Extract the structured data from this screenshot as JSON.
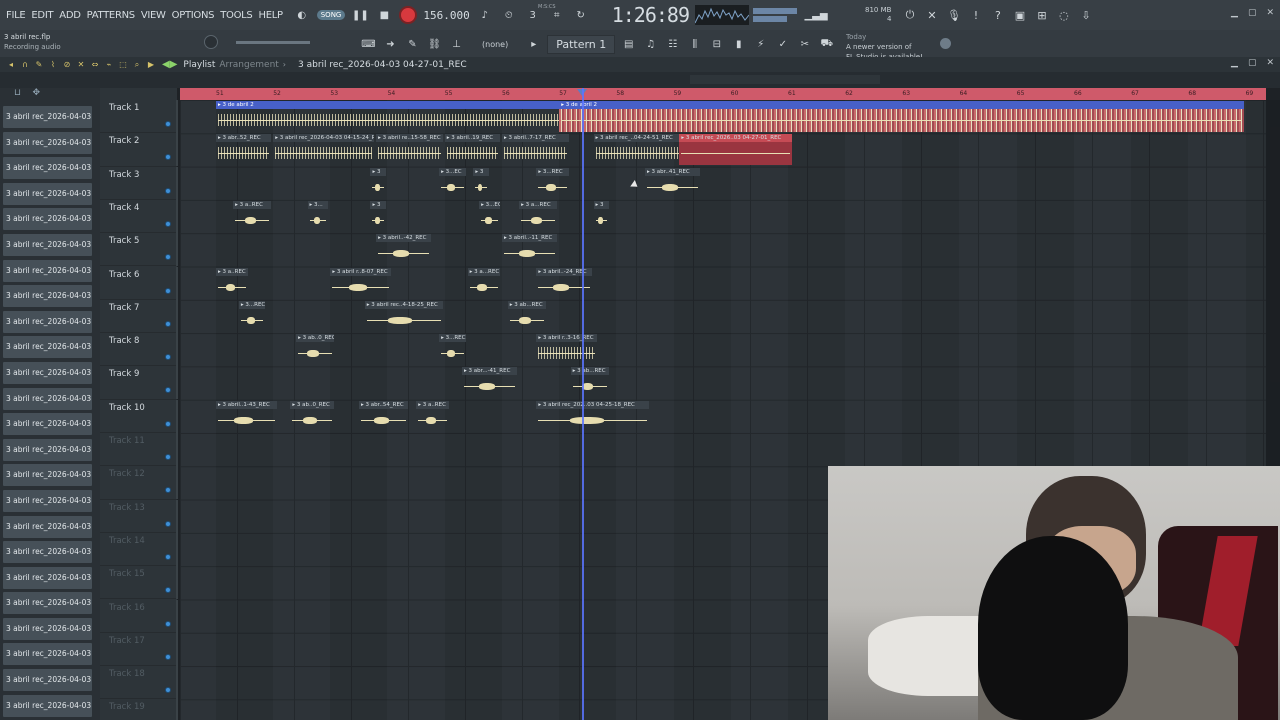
{
  "menu": [
    "FILE",
    "EDIT",
    "ADD",
    "PATTERNS",
    "VIEW",
    "OPTIONS",
    "TOOLS",
    "HELP"
  ],
  "transport": {
    "mode_label": "SONG",
    "tempo": "156.000",
    "time": "1:26:89",
    "time_unit": "M:S:CS"
  },
  "cpu_mem": {
    "mem": "810 MB",
    "poly": "4"
  },
  "hint": {
    "file": "3 abril rec.flp",
    "status": "Recording audio"
  },
  "snap": {
    "value": "(none)"
  },
  "pattern": {
    "name": "Pattern 1"
  },
  "news": {
    "line1": "Today",
    "line2": "A newer version of",
    "line3": "FL Studio is available!"
  },
  "playlist": {
    "title": "Playlist",
    "subtitle": "Arrangement",
    "file": "3 abril rec_2026-04-03 04-27-01_REC"
  },
  "patterns_list": [
    "3 abril rec_2026-04-03 0...",
    "3 abril rec_2026-04-03 0...",
    "3 abril rec_2026-04-03 0...",
    "3 abril rec_2026-04-03 0...",
    "3 abril rec_2026-04-03 0...",
    "3 abril rec_2026-04-03 0...",
    "3 abril rec_2026-04-03 0...",
    "3 abril rec_2026-04-03 0...",
    "3 abril rec_2026-04-03 0...",
    "3 abril rec_2026-04-03 0...",
    "3 abril rec_2026-04-03 0...",
    "3 abril rec_2026-04-03 0...",
    "3 abril rec_2026-04-03 0...",
    "3 abril rec_2026-04-03 0...",
    "3 abril rec_2026-04-03 0...",
    "3 abril rec_2026-04-03 0...",
    "3 abril rec_2026-04-03 0...",
    "3 abril rec_2026-04-03 0...",
    "3 abril rec_2026-04-03 0...",
    "3 abril rec_2026-04-03 0...",
    "3 abril rec_2026-04-03 0...",
    "3 abril rec_2026-04-03 0...",
    "3 abril rec_2026-04-03 0...",
    "3 abril rec_2026-04-03 0..."
  ],
  "tracks": [
    {
      "name": "Track 1",
      "active": true
    },
    {
      "name": "Track 2",
      "active": true
    },
    {
      "name": "Track 3",
      "active": true
    },
    {
      "name": "Track 4",
      "active": true
    },
    {
      "name": "Track 5",
      "active": true
    },
    {
      "name": "Track 6",
      "active": true
    },
    {
      "name": "Track 7",
      "active": true
    },
    {
      "name": "Track 8",
      "active": true
    },
    {
      "name": "Track 9",
      "active": true
    },
    {
      "name": "Track 10",
      "active": true
    },
    {
      "name": "Track 11",
      "active": false
    },
    {
      "name": "Track 12",
      "active": false
    },
    {
      "name": "Track 13",
      "active": false
    },
    {
      "name": "Track 14",
      "active": false
    },
    {
      "name": "Track 15",
      "active": false
    },
    {
      "name": "Track 16",
      "active": false
    },
    {
      "name": "Track 17",
      "active": false
    },
    {
      "name": "Track 18",
      "active": false
    },
    {
      "name": "Track 19",
      "active": false
    }
  ],
  "ruler_bars": [
    "51",
    "52",
    "53",
    "54",
    "55",
    "56",
    "57",
    "58",
    "59",
    "60",
    "61",
    "62",
    "63",
    "64",
    "65",
    "66",
    "67",
    "68",
    "69"
  ],
  "clips": [
    {
      "track": 0,
      "bar": 51.0,
      "len": 6.1,
      "label": "3 de abril 2",
      "style": "blue w"
    },
    {
      "track": 0,
      "bar": 57.0,
      "len": 12.0,
      "label": "3 de abril 2",
      "style": "blue redwave"
    },
    {
      "track": 1,
      "bar": 51.0,
      "len": 1.0,
      "label": "3 abr..52_REC",
      "style": "w"
    },
    {
      "track": 1,
      "bar": 52.0,
      "len": 1.8,
      "label": "3 abril rec_2026-04-03 04-15-24_REC",
      "style": "w"
    },
    {
      "track": 1,
      "bar": 53.8,
      "len": 1.2,
      "label": "3 abril re..15-58_REC",
      "style": "w"
    },
    {
      "track": 1,
      "bar": 55.0,
      "len": 1.0,
      "label": "3 abril..19_REC",
      "style": "w"
    },
    {
      "track": 1,
      "bar": 56.0,
      "len": 1.2,
      "label": "3 abril..7-17_REC",
      "style": "w"
    },
    {
      "track": 1,
      "bar": 57.6,
      "len": 1.6,
      "label": "3 abril rec_..04-24-51_REC",
      "style": "w"
    },
    {
      "track": 1,
      "bar": 59.1,
      "len": 2.0,
      "label": "3 abril rec_2026..03 04-27-01_REC",
      "style": "red"
    },
    {
      "track": 2,
      "bar": 53.7,
      "len": 0.3,
      "label": "3",
      "style": "s"
    },
    {
      "track": 2,
      "bar": 54.9,
      "len": 0.5,
      "label": "3...EC",
      "style": "s"
    },
    {
      "track": 2,
      "bar": 55.5,
      "len": 0.3,
      "label": "3",
      "style": "s"
    },
    {
      "track": 2,
      "bar": 56.6,
      "len": 0.6,
      "label": "3...REC",
      "style": "s"
    },
    {
      "track": 2,
      "bar": 58.5,
      "len": 1.0,
      "label": "3 abr..41_REC",
      "style": "s"
    },
    {
      "track": 3,
      "bar": 51.3,
      "len": 0.7,
      "label": "3 a..REC",
      "style": "s"
    },
    {
      "track": 3,
      "bar": 52.6,
      "len": 0.4,
      "label": "3...",
      "style": "s"
    },
    {
      "track": 3,
      "bar": 53.7,
      "len": 0.3,
      "label": "3",
      "style": "s"
    },
    {
      "track": 3,
      "bar": 55.6,
      "len": 0.4,
      "label": "3...EC",
      "style": "s"
    },
    {
      "track": 3,
      "bar": 56.3,
      "len": 0.7,
      "label": "3 a...REC",
      "style": "s"
    },
    {
      "track": 3,
      "bar": 57.6,
      "len": 0.3,
      "label": "3",
      "style": "s"
    },
    {
      "track": 4,
      "bar": 53.8,
      "len": 1.0,
      "label": "3 abril..-42_REC",
      "style": "s"
    },
    {
      "track": 4,
      "bar": 56.0,
      "len": 1.0,
      "label": "3 abril..-11_REC",
      "style": "s"
    },
    {
      "track": 5,
      "bar": 51.0,
      "len": 0.6,
      "label": "3 a..REC",
      "style": "s"
    },
    {
      "track": 5,
      "bar": 53.0,
      "len": 1.1,
      "label": "3 abril r..8-07_REC",
      "style": "s"
    },
    {
      "track": 5,
      "bar": 55.4,
      "len": 0.6,
      "label": "3 a...REC",
      "style": "s"
    },
    {
      "track": 5,
      "bar": 56.6,
      "len": 1.0,
      "label": "3 abril..-24_REC",
      "style": "s"
    },
    {
      "track": 6,
      "bar": 51.4,
      "len": 0.5,
      "label": "3...REC",
      "style": "s"
    },
    {
      "track": 6,
      "bar": 53.6,
      "len": 1.4,
      "label": "3 abril rec..4-18-25_REC",
      "style": "s"
    },
    {
      "track": 6,
      "bar": 56.1,
      "len": 0.7,
      "label": "3 ab...REC",
      "style": "s"
    },
    {
      "track": 7,
      "bar": 52.4,
      "len": 0.7,
      "label": "3 ab..0_REC",
      "style": "s"
    },
    {
      "track": 7,
      "bar": 54.9,
      "len": 0.5,
      "label": "3...REC",
      "style": "s"
    },
    {
      "track": 7,
      "bar": 56.6,
      "len": 1.1,
      "label": "3 abril r..3-16_REC",
      "style": "w"
    },
    {
      "track": 8,
      "bar": 55.3,
      "len": 1.0,
      "label": "3 abr...-41_REC",
      "style": "s"
    },
    {
      "track": 8,
      "bar": 57.2,
      "len": 0.7,
      "label": "3 ab...REC",
      "style": "s"
    },
    {
      "track": 9,
      "bar": 51.0,
      "len": 1.1,
      "label": "3 abril..1-43_REC",
      "style": "s"
    },
    {
      "track": 9,
      "bar": 52.3,
      "len": 0.8,
      "label": "3 ab..0_REC",
      "style": "s"
    },
    {
      "track": 9,
      "bar": 53.5,
      "len": 0.9,
      "label": "3 abr..54_REC",
      "style": "s"
    },
    {
      "track": 9,
      "bar": 54.5,
      "len": 0.6,
      "label": "3 a..REC",
      "style": "s"
    },
    {
      "track": 9,
      "bar": 56.6,
      "len": 2.0,
      "label": "3 abril rec_202..03 04-25-18_REC",
      "style": "s"
    }
  ],
  "playhead_bar": 57.4,
  "icons": [
    "play-icon",
    "stop-icon",
    "record-icon",
    "metronome-icon",
    "undo-icon",
    "save-icon",
    "mixer-icon",
    "piano-roll-icon",
    "browser-icon",
    "channel-rack-icon"
  ]
}
